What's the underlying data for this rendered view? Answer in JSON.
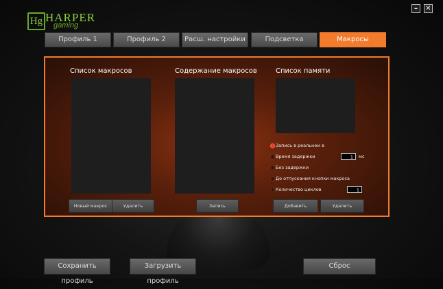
{
  "logo": {
    "box_text": "Hg",
    "name": "HARPER",
    "sub": "gaming"
  },
  "window": {
    "minimize": "–",
    "close": "✕"
  },
  "tabs": [
    {
      "label": "Профиль 1",
      "active": false
    },
    {
      "label": "Профиль 2",
      "active": false
    },
    {
      "label": "Расш. настройки",
      "active": false
    },
    {
      "label": "Подсветка",
      "active": false
    },
    {
      "label": "Макросы",
      "active": true
    }
  ],
  "macros": {
    "list_title": "Список макросов",
    "content_title": "Содержание макросов",
    "memory_title": "Список памяти",
    "new_macro": "Новый макрос",
    "delete": "Удалить",
    "record": "Запись",
    "add": "Добавить",
    "delete2": "Удалить"
  },
  "options": {
    "realtime": "Запись в реальном в",
    "delay_time": "Время задержки",
    "delay_value": "1",
    "delay_unit": "мс",
    "no_delay": "Без задержки",
    "until_release": "До отпускания кнопки макроса",
    "cycles": "Количество циклов",
    "cycles_value": "1"
  },
  "footer": {
    "save": "Сохранить профиль",
    "load": "Загрузить профиль",
    "reset": "Сброс"
  },
  "colors": {
    "accent": "#f27b2e",
    "logo": "#8bd13a",
    "radio_on": "#e23a22"
  }
}
